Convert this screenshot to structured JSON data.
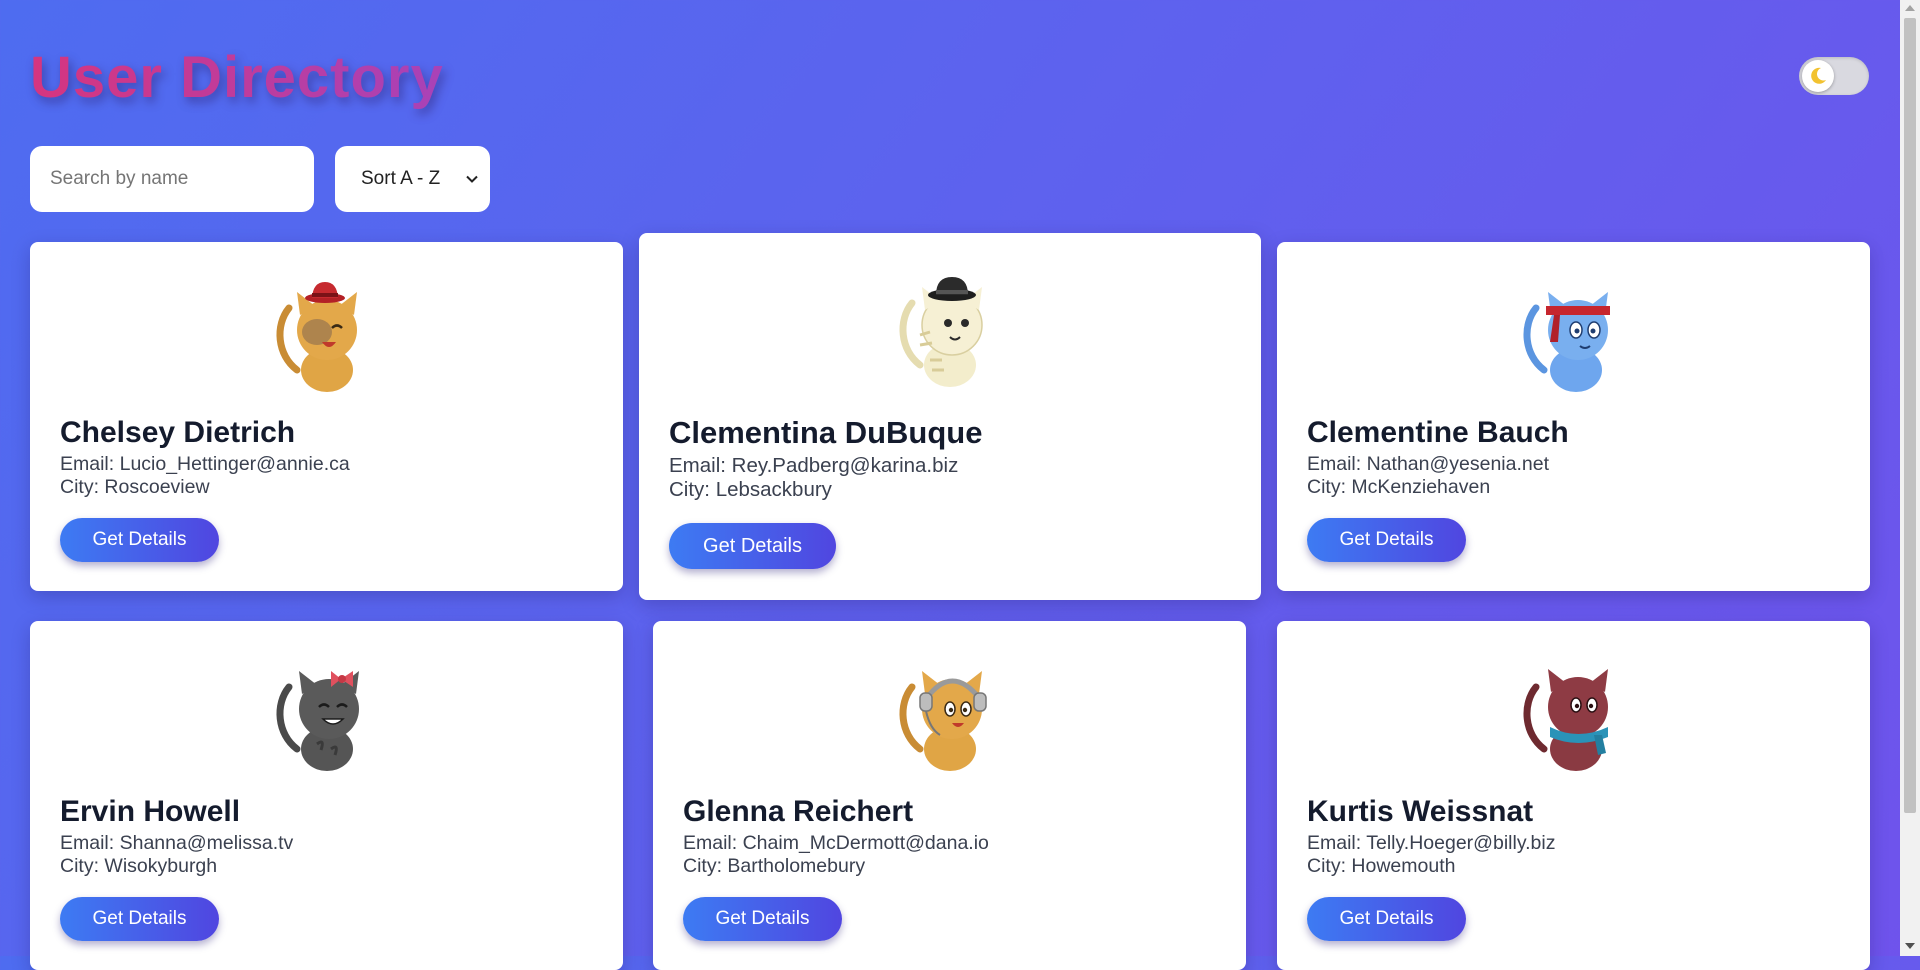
{
  "header": {
    "title": "User Directory"
  },
  "theme_toggle": {
    "icon": "moon-icon",
    "state": "light"
  },
  "controls": {
    "search_placeholder": "Search by name",
    "search_value": "",
    "sort_selected": "Sort A - Z"
  },
  "button_label": "Get Details",
  "colors": {
    "accent_start": "#3d7bf3",
    "accent_end": "#5046e0",
    "title_start": "#d6357f",
    "title_end": "#a842b8"
  },
  "users": [
    {
      "name": "Chelsey Dietrich",
      "email": "Email: Lucio_Hettinger@annie.ca",
      "city": "City: Roscoeview",
      "avatar": "orange-cat-red-hat-icon"
    },
    {
      "name": "Clementina DuBuque",
      "email": "Email: Rey.Padberg@karina.biz",
      "city": "City: Lebsackbury",
      "avatar": "cream-cat-black-hat-icon"
    },
    {
      "name": "Clementine Bauch",
      "email": "Email: Nathan@yesenia.net",
      "city": "City: McKenziehaven",
      "avatar": "blue-cat-red-headband-icon"
    },
    {
      "name": "Ervin Howell",
      "email": "Email: Shanna@melissa.tv",
      "city": "City: Wisokyburgh",
      "avatar": "gray-cat-pink-bow-icon"
    },
    {
      "name": "Glenna Reichert",
      "email": "Email: Chaim_McDermott@dana.io",
      "city": "City: Bartholomebury",
      "avatar": "orange-cat-headphones-icon"
    },
    {
      "name": "Kurtis Weissnat",
      "email": "Email: Telly.Hoeger@billy.biz",
      "city": "City: Howemouth",
      "avatar": "maroon-cat-blue-scarf-icon"
    }
  ]
}
